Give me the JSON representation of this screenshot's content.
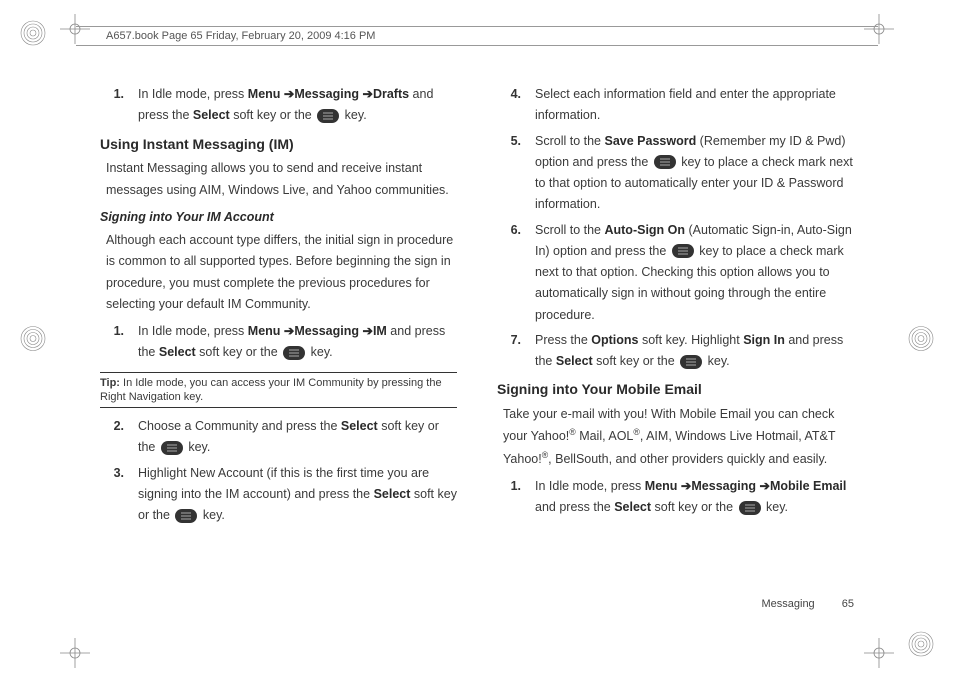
{
  "header_stamp": "A657.book  Page 65  Friday, February 20, 2009  4:16 PM",
  "footer_section": "Messaging",
  "footer_page": "65",
  "left": {
    "step1_prefix": "In Idle mode, press ",
    "step1_menu": "Menu",
    "step1_msg": "Messaging",
    "step1_drafts": "Drafts",
    "step1_mid": " and press the ",
    "step1_select": "Select",
    "step1_tail": " soft key or the ",
    "step1_end": " key.",
    "h_im": "Using Instant Messaging (IM)",
    "im_para": "Instant Messaging allows you to send and receive instant messages using AIM, Windows Live, and Yahoo communities.",
    "h_signin": "Signing into Your IM Account",
    "signin_para": "Although each account type differs, the initial sign in procedure is common to all supported types. Before beginning the sign in procedure, you must complete the previous procedures for selecting your default IM Community.",
    "signin1_prefix": "In Idle mode, press ",
    "signin1_menu": "Menu",
    "signin1_msg": "Messaging",
    "signin1_im": "IM",
    "signin1_mid": " and press the ",
    "signin1_select": "Select",
    "signin1_tail": " soft key or the ",
    "signin1_end": " key.",
    "tip_label": "Tip:",
    "tip_text": " In Idle mode, you can access your IM Community by pressing the Right Navigation key.",
    "signin2_pre": "Choose a Community and press the ",
    "signin2_select": "Select",
    "signin2_mid": " soft key or the ",
    "signin2_end": " key.",
    "signin3_pre": "Highlight New Account (if this is the first time you are signing into the IM account) and press the ",
    "signin3_select": "Select",
    "signin3_mid": " soft key or the ",
    "signin3_end": " key."
  },
  "right": {
    "step4": "Select each information field and enter the appropriate information.",
    "step5_pre": "Scroll to the ",
    "step5_b": "Save Password",
    "step5_paren": " (Remember my ID & Pwd) option and press the ",
    "step5_mid": " key to place a check mark next to that option to automatically enter your ID & Password information.",
    "step6_pre": "Scroll to the ",
    "step6_b": "Auto-Sign On",
    "step6_paren": " (Automatic Sign-in, Auto-Sign In) option and press the ",
    "step6_mid": " key to place a check mark next to that option. Checking this option allows you to automatically sign in without going through the entire procedure.",
    "step7_pre": "Press the ",
    "step7_opt": "Options",
    "step7_mid1": " soft key. Highlight ",
    "step7_signin": "Sign In",
    "step7_mid2": " and press the ",
    "step7_select": "Select",
    "step7_mid3": " soft key or the ",
    "step7_end": " key.",
    "h_mobile": "Signing into Your Mobile Email",
    "mobile_para_1": "Take your e-mail with you! With Mobile Email you can check your Yahoo!",
    "mobile_para_2": " Mail, AOL",
    "mobile_para_3": ", AIM, Windows Live Hotmail, AT&T Yahoo!",
    "mobile_para_4": ", BellSouth, and other providers quickly and easily.",
    "mstep1_pre": "In Idle mode, press ",
    "mstep1_menu": "Menu",
    "mstep1_msg": "Messaging",
    "mstep1_me": "Mobile Email",
    "mstep1_mid": " and press the ",
    "mstep1_select": "Select",
    "mstep1_tail": " soft key or the ",
    "mstep1_end": " key."
  }
}
